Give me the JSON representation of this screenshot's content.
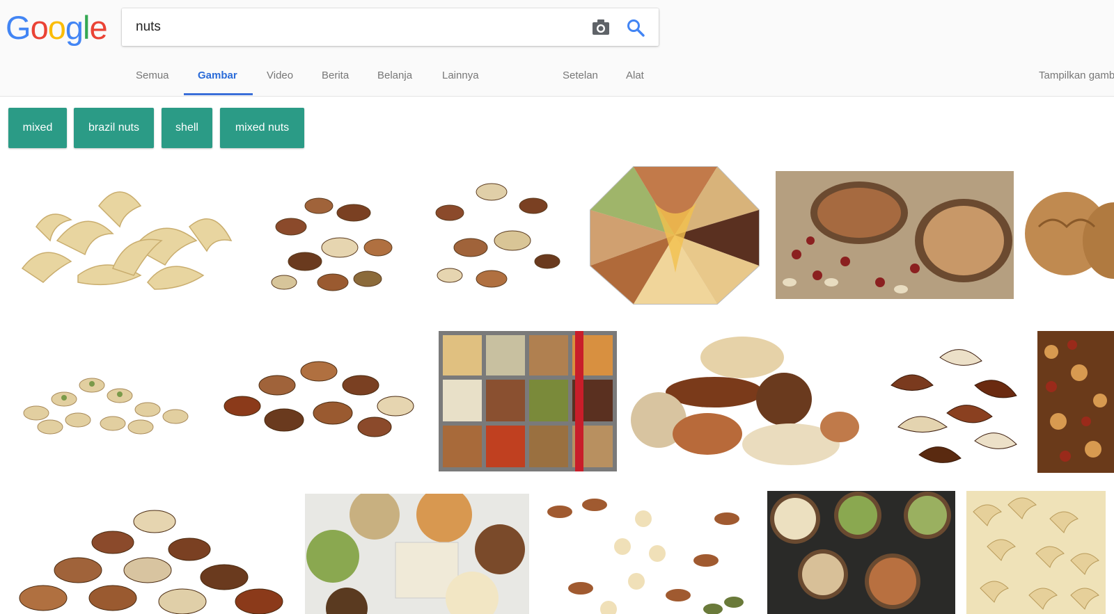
{
  "logo": {
    "text": "Google"
  },
  "search": {
    "query": "nuts",
    "placeholder": ""
  },
  "tabs": [
    {
      "label": "Semua",
      "active": false
    },
    {
      "label": "Gambar",
      "active": true
    },
    {
      "label": "Video",
      "active": false
    },
    {
      "label": "Berita",
      "active": false
    },
    {
      "label": "Belanja",
      "active": false
    },
    {
      "label": "Lainnya",
      "active": false
    }
  ],
  "tools": [
    {
      "label": "Setelan"
    },
    {
      "label": "Alat"
    }
  ],
  "safe_search_label": "Tampilkan gamb",
  "chips": [
    {
      "label": "mixed"
    },
    {
      "label": "brazil nuts"
    },
    {
      "label": "shell"
    },
    {
      "label": "mixed nuts"
    }
  ],
  "colors": {
    "chip_bg": "#2b9b86",
    "active_tab": "#3b6fd9",
    "search_icon": "#4285f4"
  },
  "icons": [
    "camera-icon",
    "search-icon"
  ]
}
